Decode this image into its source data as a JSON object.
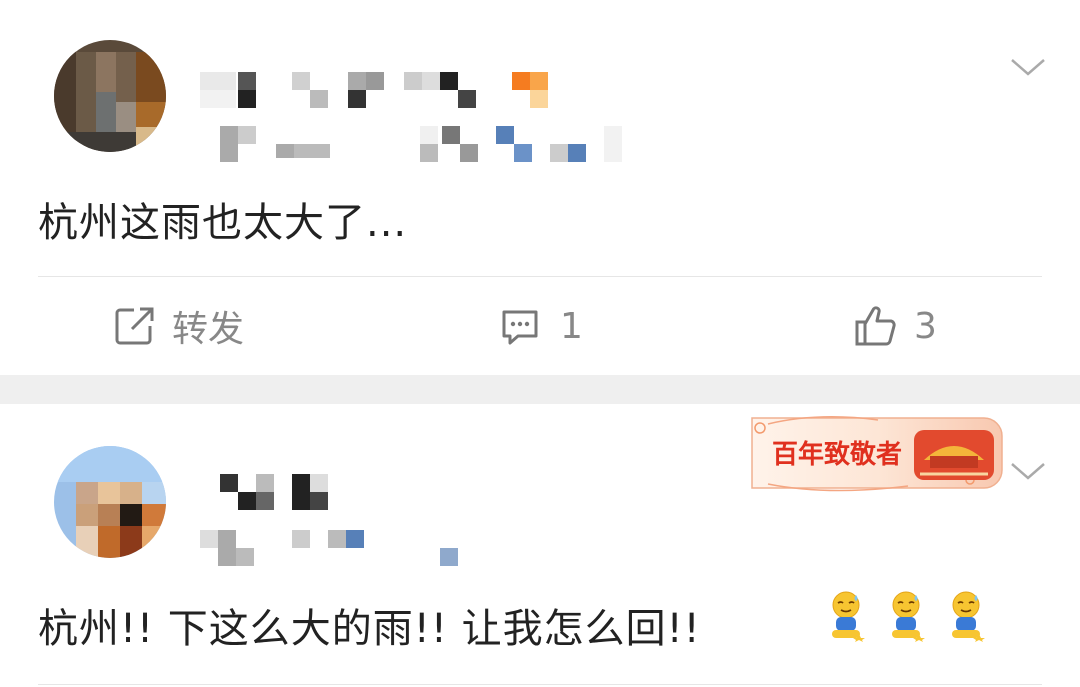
{
  "post1": {
    "text": "杭州这雨也太大了...",
    "actions": {
      "repost_label": "转发",
      "comment_count": "1",
      "like_count": "3"
    }
  },
  "post2": {
    "text": "杭州!! 下这么大的雨!! 让我怎么回!!",
    "badge_text": "百年致敬者",
    "emoji_icons": [
      "kneeling-sweat-emoji-icon",
      "kneeling-sweat-emoji-icon",
      "kneeling-sweat-emoji-icon"
    ]
  },
  "colors": {
    "text": "#222222",
    "muted": "#888888",
    "separator": "#efefef",
    "badge_red": "#e8462f",
    "badge_cream": "#fde8d6"
  }
}
